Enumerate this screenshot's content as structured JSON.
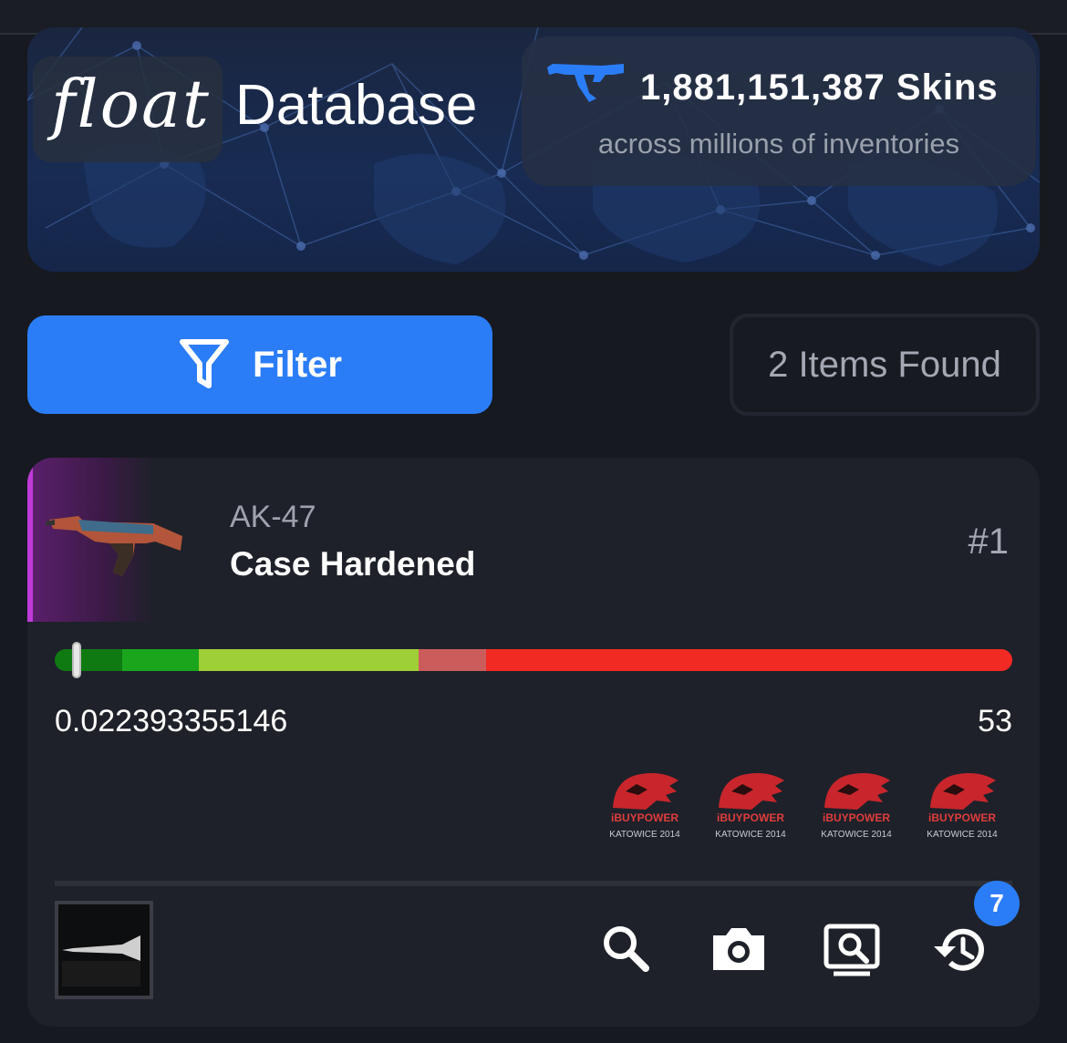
{
  "header": {
    "logo_word": "float",
    "logo_sub": "Database",
    "skins_count": "1,881,151,387 Skins",
    "skins_sub": "across millions of inventories",
    "accent": "#2b7df7"
  },
  "controls": {
    "filter_label": "Filter",
    "items_found": "2 Items Found"
  },
  "result": {
    "weapon": "AK-47",
    "skin": "Case Hardened",
    "rank": "#1",
    "float_value": "0.022393355146",
    "pattern": "53",
    "float_fraction": 0.0224,
    "rarity_color": "#c03ad8",
    "wear_segments": [
      {
        "color": "#0f7a12",
        "fraction": 0.07
      },
      {
        "color": "#1aa51d",
        "fraction": 0.08
      },
      {
        "color": "#9fcf36",
        "fraction": 0.23
      },
      {
        "color": "#cc5c5c",
        "fraction": 0.07
      },
      {
        "color": "#f22a24",
        "fraction": 0.55
      }
    ],
    "stickers": [
      {
        "name": "iBUYPOWER",
        "event": "KATOWICE 2014"
      },
      {
        "name": "iBUYPOWER",
        "event": "KATOWICE 2014"
      },
      {
        "name": "iBUYPOWER",
        "event": "KATOWICE 2014"
      },
      {
        "name": "iBUYPOWER",
        "event": "KATOWICE 2014"
      }
    ],
    "history_count": "7",
    "actions": [
      "search-icon",
      "camera-icon",
      "screenshot-search-icon",
      "history-icon"
    ]
  }
}
